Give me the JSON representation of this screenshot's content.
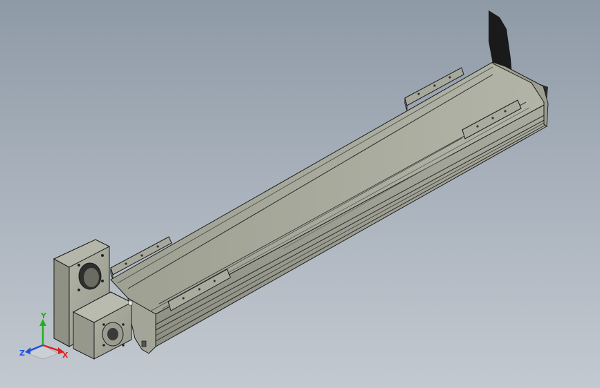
{
  "viewport": {
    "kind": "3d-cad-model-view",
    "background_top": "#8e9aa6",
    "background_bottom": "#c3c9d0",
    "model_color": "#a4a69a",
    "edge_color": "#1c1c1c"
  },
  "triad": {
    "x_label": "X",
    "y_label": "Y",
    "z_label": "Z",
    "x_color": "#e02020",
    "y_color": "#22b022",
    "z_color": "#2050e0"
  }
}
